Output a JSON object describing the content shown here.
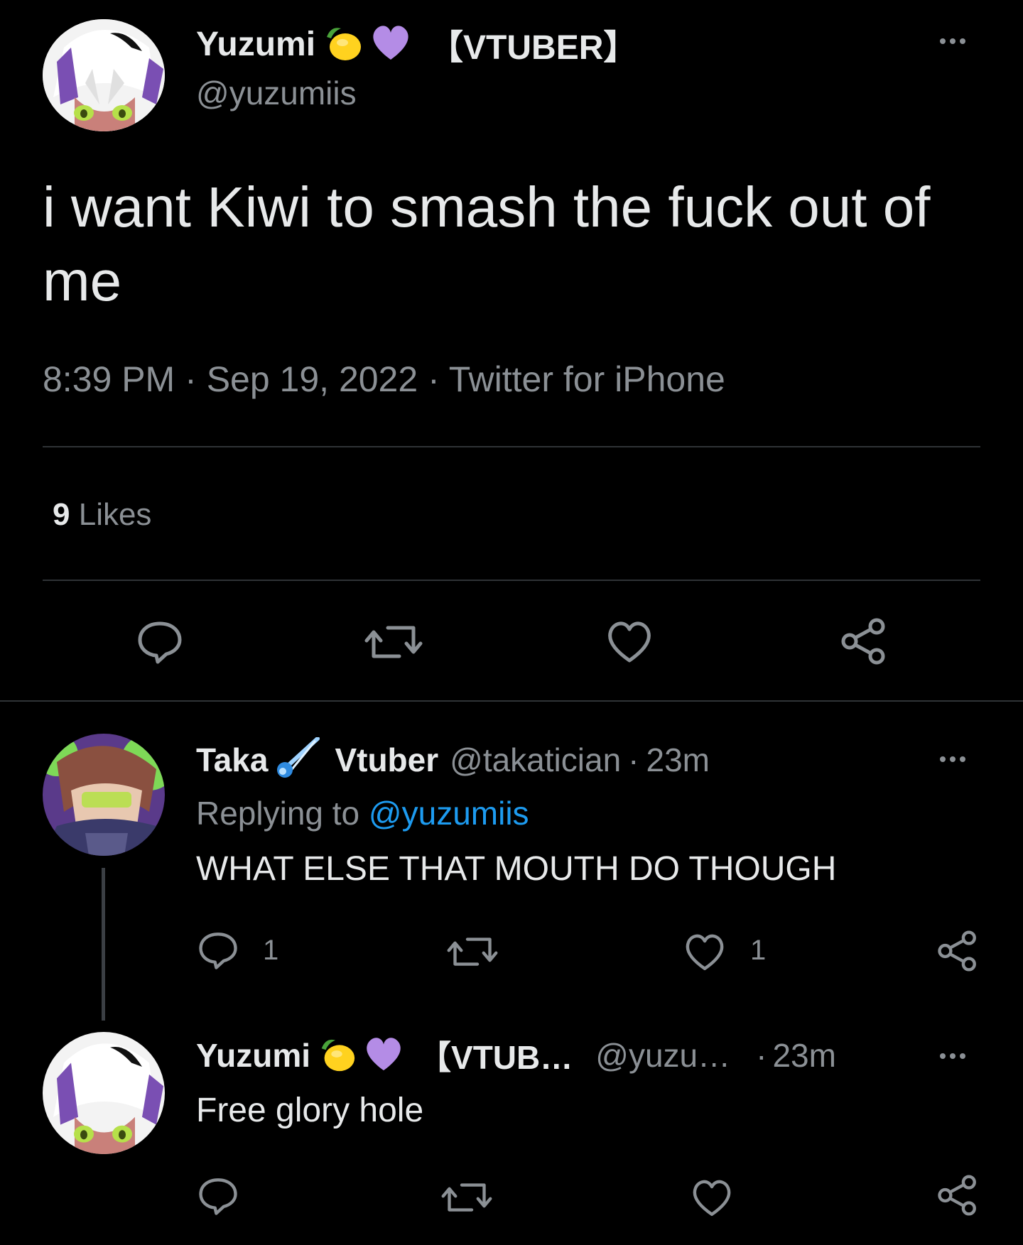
{
  "tweet": {
    "author": {
      "name": "Yuzumi",
      "tag": "【VTUBER】",
      "handle": "@yuzumiis"
    },
    "text": "i want Kiwi to smash the fuck out of me",
    "time": "8:39 PM",
    "date": "Sep 19, 2022",
    "source": "Twitter for iPhone",
    "likes_count": "9",
    "likes_label": "Likes",
    "sep": "·"
  },
  "reply1": {
    "name_part1": "Taka",
    "name_part2": "Vtuber",
    "handle": "@takatician",
    "sep": "·",
    "time": "23m",
    "replying_prefix": "Replying to",
    "replying_handle": "@yuzumiis",
    "text": "WHAT ELSE THAT MOUTH DO THOUGH",
    "reply_count": "1",
    "like_count": "1"
  },
  "reply2": {
    "name": "Yuzumi",
    "tag": "【VTUB…",
    "handle": "@yuzu…",
    "sep": "·",
    "time": "23m",
    "text": "Free glory hole"
  },
  "icons": {
    "more": "more-dots-icon",
    "reply": "reply-bubble-icon",
    "retweet": "retweet-icon",
    "like": "heart-icon",
    "share": "share-icon",
    "emoji_lemon": "lemon-emoji",
    "emoji_heart": "purple-heart-emoji",
    "emoji_comet": "comet-emoji"
  },
  "colors": {
    "background": "#000000",
    "text": "#e7e9ea",
    "muted": "#8b9095",
    "link": "#1d9bf0",
    "accent_heart": "#b48ce6"
  }
}
